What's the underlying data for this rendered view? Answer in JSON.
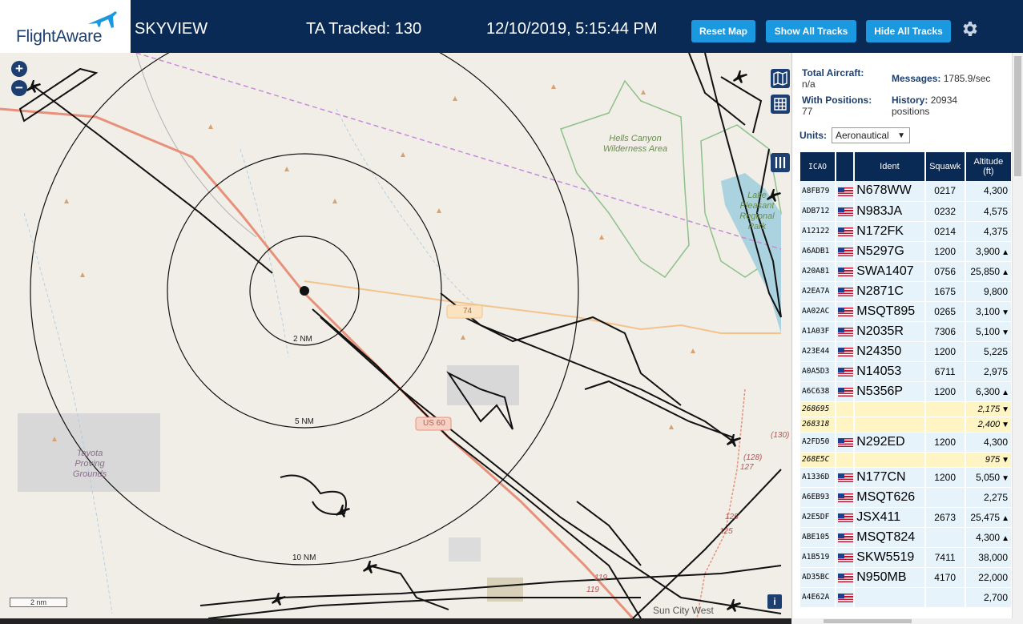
{
  "header": {
    "logo_text": "FlightAware",
    "app_title": "SKYVIEW",
    "ta_tracked": "TA Tracked: 130",
    "datetime": "12/10/2019, 5:15:44 PM",
    "reset_map": "Reset Map",
    "show_all_tracks": "Show All Tracks",
    "hide_all_tracks": "Hide All Tracks",
    "settings_icon": "gear-icon"
  },
  "map": {
    "zoom_in": "+",
    "zoom_out": "−",
    "range_labels": [
      "2 NM",
      "5 NM",
      "10 NM"
    ],
    "scale_label": "2 nm",
    "info_label": "i",
    "place_labels": {
      "hells_canyon": "Hells Canyon Wilderness Area",
      "lake_park": "Lake Pleasant Regional Park",
      "tayota": "Tayota Proving Grounds",
      "sun_city_west": "Sun City West",
      "us60": "US 60",
      "road_74": "74"
    },
    "road_numbers": [
      "(130)",
      "(128)",
      "127",
      "125",
      "125",
      "119",
      "119"
    ],
    "tool_icons": [
      "map-layers-icon",
      "grid-icon",
      "columns-icon"
    ]
  },
  "panel": {
    "total_aircraft_label": "Total Aircraft:",
    "total_aircraft_value": "n/a",
    "messages_label": "Messages:",
    "messages_value": "1785.9/sec",
    "with_positions_label": "With Positions:",
    "with_positions_value": "77",
    "history_label": "History:",
    "history_value": "20934 positions",
    "units_label": "Units:",
    "units_value": "Aeronautical",
    "columns": [
      "ICAO",
      "",
      "Ident",
      "Squawk",
      "Altitude (ft)"
    ],
    "rows": [
      {
        "icao": "A8FB79",
        "flag": true,
        "ident": "N678WW",
        "squawk": "0217",
        "alt": "4,300",
        "trend": "",
        "yellow": false
      },
      {
        "icao": "ADB712",
        "flag": true,
        "ident": "N983JA",
        "squawk": "0232",
        "alt": "4,575",
        "trend": "",
        "yellow": false
      },
      {
        "icao": "A12122",
        "flag": true,
        "ident": "N172FK",
        "squawk": "0214",
        "alt": "4,375",
        "trend": "",
        "yellow": false
      },
      {
        "icao": "A6ADB1",
        "flag": true,
        "ident": "N5297G",
        "squawk": "1200",
        "alt": "3,900",
        "trend": "▲",
        "yellow": false
      },
      {
        "icao": "A20A81",
        "flag": true,
        "ident": "SWA1407",
        "squawk": "0756",
        "alt": "25,850",
        "trend": "▲",
        "yellow": false
      },
      {
        "icao": "A2EA7A",
        "flag": true,
        "ident": "N2871C",
        "squawk": "1675",
        "alt": "9,800",
        "trend": "",
        "yellow": false
      },
      {
        "icao": "AA02AC",
        "flag": true,
        "ident": "MSQT895",
        "squawk": "0265",
        "alt": "3,100",
        "trend": "▼",
        "yellow": false
      },
      {
        "icao": "A1A03F",
        "flag": true,
        "ident": "N2035R",
        "squawk": "7306",
        "alt": "5,100",
        "trend": "▼",
        "yellow": false
      },
      {
        "icao": "A23E44",
        "flag": true,
        "ident": "N24350",
        "squawk": "1200",
        "alt": "5,225",
        "trend": "",
        "yellow": false
      },
      {
        "icao": "A0A5D3",
        "flag": true,
        "ident": "N14053",
        "squawk": "6711",
        "alt": "2,975",
        "trend": "",
        "yellow": false
      },
      {
        "icao": "A6C638",
        "flag": true,
        "ident": "N5356P",
        "squawk": "1200",
        "alt": "6,300",
        "trend": "▲",
        "yellow": false
      },
      {
        "icao": "268695",
        "flag": false,
        "ident": "",
        "squawk": "",
        "alt": "2,175",
        "trend": "▼",
        "yellow": true
      },
      {
        "icao": "268318",
        "flag": false,
        "ident": "",
        "squawk": "",
        "alt": "2,400",
        "trend": "▼",
        "yellow": true
      },
      {
        "icao": "A2FD50",
        "flag": true,
        "ident": "N292ED",
        "squawk": "1200",
        "alt": "4,300",
        "trend": "",
        "yellow": false
      },
      {
        "icao": "268E5C",
        "flag": false,
        "ident": "",
        "squawk": "",
        "alt": "975",
        "trend": "▼",
        "yellow": true
      },
      {
        "icao": "A1336D",
        "flag": true,
        "ident": "N177CN",
        "squawk": "1200",
        "alt": "5,050",
        "trend": "▼",
        "yellow": false
      },
      {
        "icao": "A6EB93",
        "flag": true,
        "ident": "MSQT626",
        "squawk": "",
        "alt": "2,275",
        "trend": "",
        "yellow": false
      },
      {
        "icao": "A2E5DF",
        "flag": true,
        "ident": "JSX411",
        "squawk": "2673",
        "alt": "25,475",
        "trend": "▲",
        "yellow": false
      },
      {
        "icao": "ABE105",
        "flag": true,
        "ident": "MSQT824",
        "squawk": "",
        "alt": "4,300",
        "trend": "▲",
        "yellow": false
      },
      {
        "icao": "A1B519",
        "flag": true,
        "ident": "SKW5519",
        "squawk": "7411",
        "alt": "38,000",
        "trend": "",
        "yellow": false
      },
      {
        "icao": "AD35BC",
        "flag": true,
        "ident": "N950MB",
        "squawk": "4170",
        "alt": "22,000",
        "trend": "",
        "yellow": false
      },
      {
        "icao": "A4E62A",
        "flag": true,
        "ident": "",
        "squawk": "",
        "alt": "2,700",
        "trend": "",
        "yellow": false
      }
    ]
  },
  "colors": {
    "header_bg": "#0a2a56",
    "button_bg": "#1a98e0",
    "map_bg": "#f0eee7",
    "highway": "#e8907a",
    "track": "#111111",
    "row_bg": "#e6f3fb",
    "row_yellow": "#fef4c4"
  }
}
